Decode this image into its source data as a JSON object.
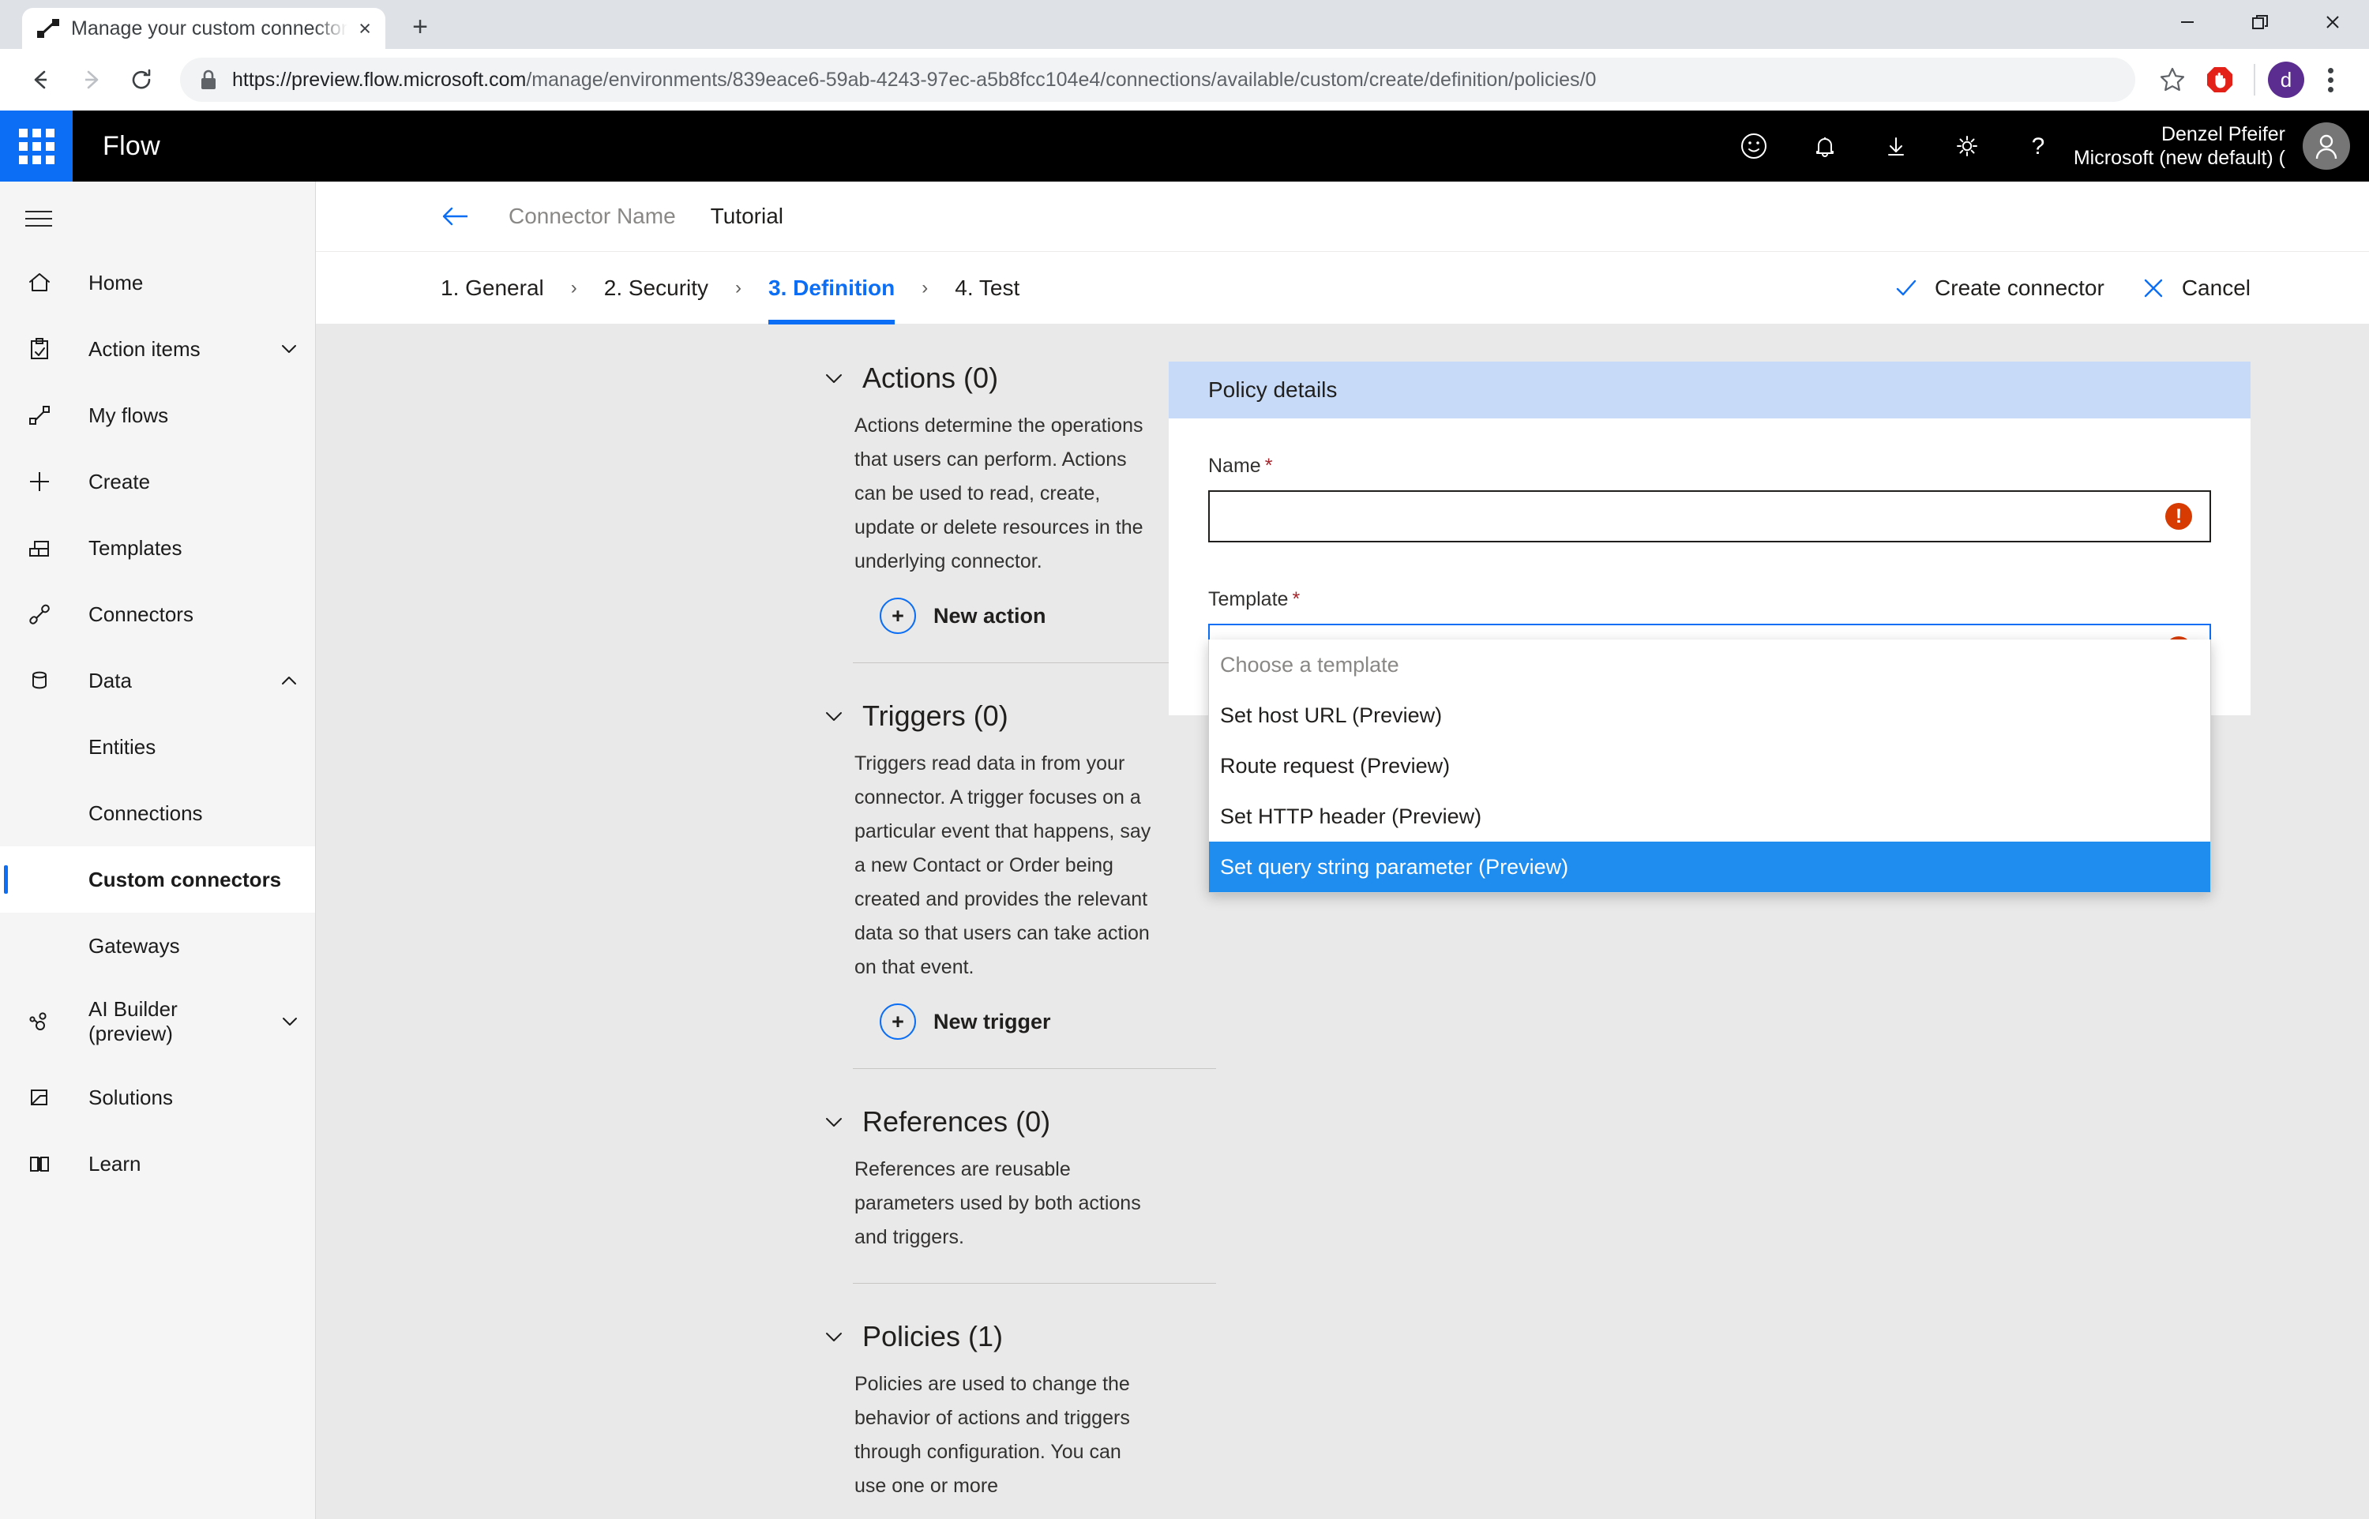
{
  "browser": {
    "tab": {
      "title": "Manage your custom connectors",
      "favicon_name": "flow-favicon",
      "close_label": "×"
    },
    "new_tab_label": "+",
    "window_controls": {
      "minimize": "—",
      "maximize": "❐",
      "close": "✕"
    },
    "nav": {
      "back": "←",
      "forward": "→",
      "reload": "⟳"
    },
    "url_scheme_host": "https://preview.flow.microsoft.com",
    "url_path": "/manage/environments/839eace6-59ab-4243-97ec-a5b8fcc104e4/connections/available/custom/create/definition/policies/0",
    "bookmark_icon": "star-icon",
    "extension_icon": "adblock-icon",
    "profile_initial": "d",
    "menu_icon": "kebab-menu-icon"
  },
  "header": {
    "waffle_label": "app-launcher",
    "brand": "Flow",
    "icons": [
      "feedback-smiley-icon",
      "notification-bell-icon",
      "download-icon",
      "settings-gear-icon",
      "help-question-icon"
    ],
    "user_name": "Denzel Pfeifer",
    "user_org": "Microsoft (new default) ("
  },
  "sidebar": {
    "hamburger_label": "menu-toggle",
    "items": [
      {
        "label": "Home",
        "icon": "home-icon",
        "has_chevron": false,
        "sub": false,
        "active": false
      },
      {
        "label": "Action items",
        "icon": "clipboard-check-icon",
        "has_chevron": true,
        "chevron": "down",
        "sub": false,
        "active": false
      },
      {
        "label": "My flows",
        "icon": "flow-icon",
        "has_chevron": false,
        "sub": false,
        "active": false
      },
      {
        "label": "Create",
        "icon": "plus-icon",
        "has_chevron": false,
        "sub": false,
        "active": false
      },
      {
        "label": "Templates",
        "icon": "templates-icon",
        "has_chevron": false,
        "sub": false,
        "active": false
      },
      {
        "label": "Connectors",
        "icon": "connectors-plug-icon",
        "has_chevron": false,
        "sub": false,
        "active": false
      },
      {
        "label": "Data",
        "icon": "database-icon",
        "has_chevron": true,
        "chevron": "up",
        "sub": false,
        "active": false
      },
      {
        "label": "Entities",
        "icon": "",
        "has_chevron": false,
        "sub": true,
        "active": false
      },
      {
        "label": "Connections",
        "icon": "",
        "has_chevron": false,
        "sub": true,
        "active": false
      },
      {
        "label": "Custom connectors",
        "icon": "",
        "has_chevron": false,
        "sub": true,
        "active": true
      },
      {
        "label": "Gateways",
        "icon": "",
        "has_chevron": false,
        "sub": true,
        "active": false
      },
      {
        "label": "AI Builder (preview)",
        "icon": "ai-builder-icon",
        "has_chevron": true,
        "chevron": "down",
        "sub": false,
        "active": false
      },
      {
        "label": "Solutions",
        "icon": "solutions-icon",
        "has_chevron": false,
        "sub": false,
        "active": false
      },
      {
        "label": "Learn",
        "icon": "book-icon",
        "has_chevron": false,
        "sub": false,
        "active": false
      }
    ]
  },
  "breadcrumb": {
    "back_icon": "back-arrow-icon",
    "connector_name": "Connector Name",
    "current": "Tutorial"
  },
  "wizard": {
    "steps": [
      {
        "label": "1. General",
        "active": false
      },
      {
        "label": "2. Security",
        "active": false
      },
      {
        "label": "3. Definition",
        "active": true
      },
      {
        "label": "4. Test",
        "active": false
      }
    ],
    "separator": "›",
    "create_label": "Create connector",
    "create_icon": "checkmark-icon",
    "cancel_label": "Cancel",
    "cancel_icon": "close-x-icon"
  },
  "definition": {
    "sections": [
      {
        "title": "Actions (0)",
        "description": "Actions determine the operations that users can perform. Actions can be used to read, create, update or delete resources in the underlying connector.",
        "button": "New action",
        "has_button": true,
        "divider": true
      },
      {
        "title": "Triggers (0)",
        "description": "Triggers read data in from your connector. A trigger focuses on a particular event that happens, say a new Contact or Order being created and provides the relevant data so that users can take action on that event.",
        "button": "New trigger",
        "has_button": true,
        "divider": true
      },
      {
        "title": "References (0)",
        "description": "References are reusable parameters used by both actions and triggers.",
        "button": "",
        "has_button": false,
        "divider": true
      },
      {
        "title": "Policies (1)",
        "description": "Policies are used to change the behavior of actions and triggers through configuration. You can use one or more",
        "button": "",
        "has_button": false,
        "divider": false
      }
    ],
    "collapse_icon": "chevron-down-icon"
  },
  "policy_panel": {
    "card_title": "Policy details",
    "name_label": "Name",
    "name_value": "",
    "name_required_mark": "*",
    "name_error_icon": "error-exclamation-icon",
    "template_label": "Template",
    "template_required_mark": "*",
    "template_value": "Choose a template",
    "template_error_icon": "error-exclamation-icon",
    "dropdown_options": [
      {
        "label": "Choose a template",
        "placeholder": true,
        "selected": false
      },
      {
        "label": "Set host URL (Preview)",
        "placeholder": false,
        "selected": false
      },
      {
        "label": "Route request (Preview)",
        "placeholder": false,
        "selected": false
      },
      {
        "label": "Set HTTP header (Preview)",
        "placeholder": false,
        "selected": false
      },
      {
        "label": "Set query string parameter (Preview)",
        "placeholder": false,
        "selected": true
      }
    ],
    "pager_prev_icon": "arrow-left-icon",
    "pager_next_icon": "arrow-right-icon"
  },
  "colors": {
    "accent": "#0b6ef4",
    "header_bg": "#000000",
    "panel_header_bg": "#c7dbf8",
    "selected_option_bg": "#1f8cf0",
    "error": "#d83b01",
    "required_asterisk": "#a4262c",
    "page_bg": "#e9e9e9"
  }
}
